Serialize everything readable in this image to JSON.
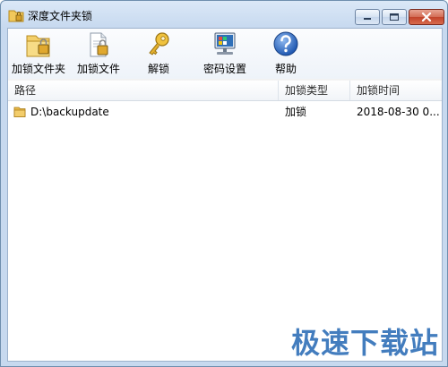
{
  "window": {
    "title": "深度文件夹锁",
    "icon": "folder-lock-icon"
  },
  "toolbar": {
    "items": [
      {
        "label": "加锁文件夹",
        "icon": "lock-folder-icon"
      },
      {
        "label": "加锁文件",
        "icon": "lock-file-icon"
      },
      {
        "label": "解锁",
        "icon": "key-icon"
      },
      {
        "label": "密码设置",
        "icon": "password-settings-icon"
      },
      {
        "label": "帮助",
        "icon": "help-icon"
      }
    ]
  },
  "table": {
    "columns": [
      "路径",
      "加锁类型",
      "加锁时间"
    ],
    "rows": [
      {
        "path": "D:\\backupdate",
        "type": "加锁",
        "time": "2018-08-30 0..."
      }
    ]
  },
  "watermark": "极速下载站",
  "colors": {
    "accent": "#2f6fb8",
    "folder": "#e8b84a"
  }
}
